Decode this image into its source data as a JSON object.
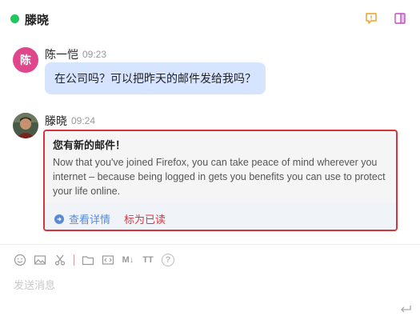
{
  "header": {
    "status_color": "#22c55e",
    "title": "滕晓",
    "icons": [
      "chat-bubble-icon",
      "side-panel-icon"
    ]
  },
  "messages": [
    {
      "avatar_text": "陈",
      "avatar_color": "#e0468c",
      "sender": "陈一恺",
      "time": "09:23",
      "text": "在公司吗？可以把昨天的邮件发给我吗？"
    },
    {
      "avatar_icon": "user-photo",
      "sender": "滕晓",
      "time": "09:24",
      "card": {
        "title": "您有新的邮件！",
        "body": "Now that you've joined Firefox, you can take peace of mind wherever you internet – because being logged in gets you benefits you can use to protect your life online.",
        "view_label": "查看详情",
        "mark_read_label": "标为已读"
      }
    }
  ],
  "toolbar": {
    "icons": [
      "emoji-icon",
      "image-icon",
      "scissors-icon",
      "folder-icon",
      "code-icon",
      "markdown-icon",
      "text-size-icon",
      "help-icon"
    ],
    "markdown_label": "M↓",
    "textsize_label": "TT",
    "help_label": "?"
  },
  "composer": {
    "placeholder": "发送消息"
  },
  "colors": {
    "accent_red": "#d9343e",
    "bubble_blue": "#d6e4ff",
    "link_blue": "#5a8ad6"
  }
}
